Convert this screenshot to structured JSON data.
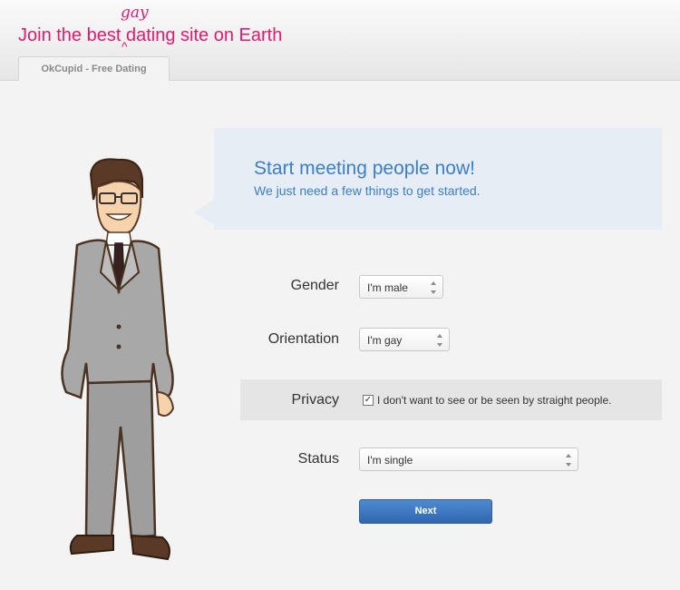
{
  "header": {
    "tagline_before": "Join the best",
    "tagline_after": " dating site on Earth",
    "insert_word": "gay",
    "insert_caret": "^",
    "tab_label": "OkCupid - Free Dating",
    "accent_color": "#e8186e"
  },
  "intro": {
    "title": "Start meeting people now!",
    "subtitle": "We just need a few things to get started.",
    "color": "#3b7ecb"
  },
  "form": {
    "gender": {
      "label": "Gender",
      "value": "I'm male"
    },
    "orientation": {
      "label": "Orientation",
      "value": "I'm gay"
    },
    "privacy": {
      "label": "Privacy",
      "checked": true,
      "checkbox_label": "I don't want to see or be seen by straight people."
    },
    "status": {
      "label": "Status",
      "value": "I'm single"
    },
    "next_label": "Next"
  },
  "illustration": {
    "icon": "cartoon-man-in-suit-icon"
  }
}
